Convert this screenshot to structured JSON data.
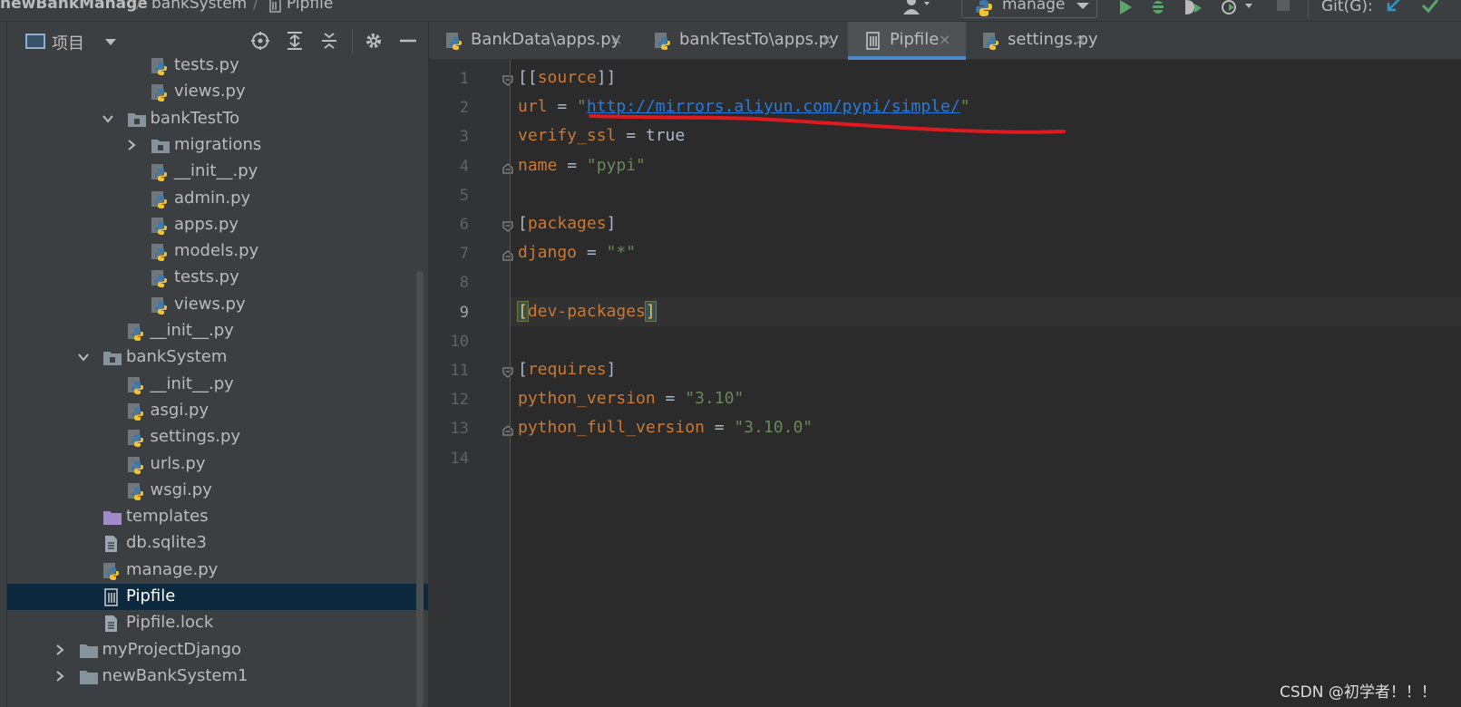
{
  "breadcrumb": {
    "project": "newBankManage",
    "folder": "bankSystem",
    "file": "Pipfile",
    "separator": "/"
  },
  "toolbar": {
    "run_config": "manage",
    "git_label": "Git(G):"
  },
  "project_panel": {
    "title": "项目",
    "tree": [
      {
        "label": "tests.py",
        "kind": "python",
        "depth": 5
      },
      {
        "label": "views.py",
        "kind": "python",
        "depth": 5
      },
      {
        "label": "bankTestTo",
        "kind": "module-folder",
        "depth": 4,
        "expanded": true
      },
      {
        "label": "migrations",
        "kind": "module-folder",
        "depth": 5,
        "expanded": false
      },
      {
        "label": "__init__.py",
        "kind": "python",
        "depth": 5
      },
      {
        "label": "admin.py",
        "kind": "python",
        "depth": 5
      },
      {
        "label": "apps.py",
        "kind": "python",
        "depth": 5
      },
      {
        "label": "models.py",
        "kind": "python",
        "depth": 5
      },
      {
        "label": "tests.py",
        "kind": "python",
        "depth": 5
      },
      {
        "label": "views.py",
        "kind": "python",
        "depth": 5
      },
      {
        "label": "__init__.py",
        "kind": "python",
        "depth": 4
      },
      {
        "label": "bankSystem",
        "kind": "module-folder",
        "depth": 3,
        "expanded": true
      },
      {
        "label": "__init__.py",
        "kind": "python",
        "depth": 4
      },
      {
        "label": "asgi.py",
        "kind": "python",
        "depth": 4
      },
      {
        "label": "settings.py",
        "kind": "python",
        "depth": 4
      },
      {
        "label": "urls.py",
        "kind": "python",
        "depth": 4
      },
      {
        "label": "wsgi.py",
        "kind": "python",
        "depth": 4
      },
      {
        "label": "templates",
        "kind": "template-folder",
        "depth": 3
      },
      {
        "label": "db.sqlite3",
        "kind": "text",
        "depth": 3
      },
      {
        "label": "manage.py",
        "kind": "python",
        "depth": 3
      },
      {
        "label": "Pipfile",
        "kind": "pipfile",
        "depth": 3,
        "selected": true
      },
      {
        "label": "Pipfile.lock",
        "kind": "text",
        "depth": 3
      },
      {
        "label": "myProjectDjango",
        "kind": "folder",
        "depth": 2,
        "expanded": false
      },
      {
        "label": "newBankSystem1",
        "kind": "folder",
        "depth": 2,
        "expanded": false
      }
    ]
  },
  "editor": {
    "tabs": [
      {
        "label": "BankData\\apps.py",
        "kind": "python",
        "active": false
      },
      {
        "label": "bankTestTo\\apps.py",
        "kind": "python",
        "active": false
      },
      {
        "label": "Pipfile",
        "kind": "pipfile",
        "active": true
      },
      {
        "label": "settings.py",
        "kind": "python",
        "active": false
      }
    ],
    "close_glyph": "×",
    "current_line": 9,
    "lines": [
      {
        "no": "1",
        "fold": "open",
        "tokens": [
          [
            "p",
            "[["
          ],
          [
            "k",
            "source"
          ],
          [
            "p",
            "]]"
          ]
        ]
      },
      {
        "no": "2",
        "fold": "",
        "tokens": [
          [
            "k",
            "url"
          ],
          [
            "p",
            " = "
          ],
          [
            "s",
            "\""
          ],
          [
            "u",
            "http://mirrors.aliyun.com/pypi/simple/"
          ],
          [
            "s",
            "\""
          ]
        ]
      },
      {
        "no": "3",
        "fold": "",
        "tokens": [
          [
            "k",
            "verify_ssl"
          ],
          [
            "p",
            " = true"
          ]
        ]
      },
      {
        "no": "4",
        "fold": "close",
        "tokens": [
          [
            "k",
            "name"
          ],
          [
            "p",
            " = "
          ],
          [
            "s",
            "\"pypi\""
          ]
        ]
      },
      {
        "no": "5",
        "fold": "",
        "tokens": []
      },
      {
        "no": "6",
        "fold": "open",
        "tokens": [
          [
            "p",
            "["
          ],
          [
            "k",
            "packages"
          ],
          [
            "p",
            "]"
          ]
        ]
      },
      {
        "no": "7",
        "fold": "close",
        "tokens": [
          [
            "k",
            "django"
          ],
          [
            "p",
            " = "
          ],
          [
            "s",
            "\"*\""
          ]
        ]
      },
      {
        "no": "8",
        "fold": "",
        "tokens": []
      },
      {
        "no": "9",
        "fold": "",
        "tokens": [
          [
            "bm",
            "["
          ],
          [
            "k",
            "dev-packages"
          ],
          [
            "bm",
            "]"
          ]
        ]
      },
      {
        "no": "10",
        "fold": "",
        "tokens": []
      },
      {
        "no": "11",
        "fold": "open",
        "tokens": [
          [
            "p",
            "["
          ],
          [
            "k",
            "requires"
          ],
          [
            "p",
            "]"
          ]
        ]
      },
      {
        "no": "12",
        "fold": "",
        "tokens": [
          [
            "k",
            "python_version"
          ],
          [
            "p",
            " = "
          ],
          [
            "s",
            "\"3.10\""
          ]
        ]
      },
      {
        "no": "13",
        "fold": "close",
        "tokens": [
          [
            "k",
            "python_full_version"
          ],
          [
            "p",
            " = "
          ],
          [
            "s",
            "\"3.10.0\""
          ]
        ]
      },
      {
        "no": "14",
        "fold": "",
        "tokens": []
      }
    ]
  },
  "watermark": "CSDN @初学者！！！",
  "colors": {
    "annotation": "#e0191f",
    "selection": "#0d293e",
    "tab_underline": "#4a88c7"
  }
}
